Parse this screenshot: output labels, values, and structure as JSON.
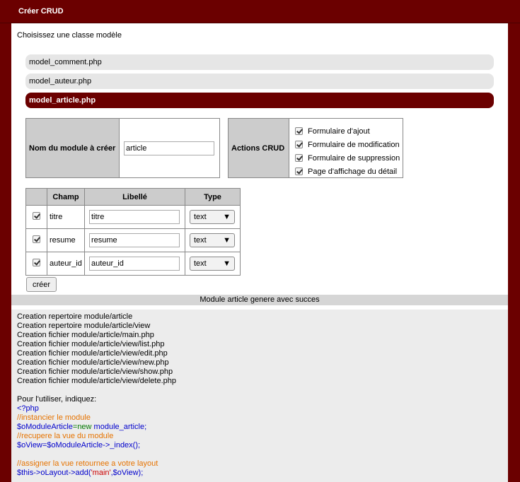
{
  "header": {
    "title": "Créer CRUD"
  },
  "intro": "Choisissez une classe modèle",
  "models": [
    {
      "label": "model_comment.php"
    },
    {
      "label": "model_auteur.php"
    },
    {
      "label": "model_article.php"
    }
  ],
  "module": {
    "label": "Nom du module à créer",
    "value": "article"
  },
  "actions": {
    "label": "Actions CRUD",
    "options": [
      "Formulaire d'ajout",
      "Formulaire de modification",
      "Formulaire de suppression",
      "Page d'affichage du détail"
    ]
  },
  "fields": {
    "headers": [
      "Champ",
      "Libellé",
      "Type"
    ],
    "rows": [
      {
        "champ": "titre",
        "libelle": "titre",
        "type": "text"
      },
      {
        "champ": "resume",
        "libelle": "resume",
        "type": "text"
      },
      {
        "champ": "auteur_id",
        "libelle": "auteur_id",
        "type": "text"
      }
    ]
  },
  "create_button": "créer",
  "status": "Module article genere avec succes",
  "log": {
    "lines": [
      "Creation repertoire module/article",
      "Creation repertoire module/article/view",
      "Creation fichier module/article/main.php",
      "Creation fichier module/article/view/list.php",
      "Creation fichier module/article/view/edit.php",
      "Creation fichier module/article/view/new.php",
      "Creation fichier module/article/view/show.php",
      "Creation fichier module/article/view/delete.php"
    ],
    "usage_intro": "Pour l'utiliser, indiquez:",
    "code_open": "<?php",
    "comment1": "//instancier le module",
    "line1_var": "$oModuleArticle",
    "line1_eq": "=",
    "line1_new": "new",
    "line1_cls": " module_article;",
    "comment2": "//recupere la vue du module",
    "line2": "$oView=$oModuleArticle->_index();",
    "comment3": "//assigner la vue retournee a votre layout",
    "line3_a": "$this->oLayout->add(",
    "line3_str": "'main'",
    "line3_b": ",$oView);"
  }
}
